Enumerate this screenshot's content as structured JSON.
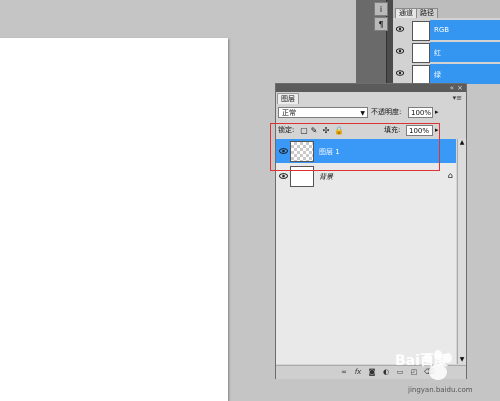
{
  "channels_panel": {
    "tabs": [
      {
        "label": "通道",
        "active": true
      },
      {
        "label": "路径",
        "active": false
      }
    ],
    "rows": [
      {
        "name": "RGB"
      },
      {
        "name": "红"
      },
      {
        "name": "绿"
      }
    ]
  },
  "layers_panel": {
    "tab_label": "图层",
    "menu_icon": "panel-menu-icon",
    "blend_mode": "正常",
    "opacity_label": "不透明度:",
    "opacity_value": "100%",
    "lock_label": "锁定:",
    "fill_label": "填充:",
    "fill_value": "100%",
    "layers": [
      {
        "name": "图层 1",
        "selected": true,
        "thumb": "transparent"
      },
      {
        "name": "背景",
        "selected": false,
        "thumb": "white",
        "locked": true
      }
    ]
  },
  "watermark": {
    "text": "Bai百度",
    "url": "jingyan.baidu.com"
  },
  "colors": {
    "selection": "#3a99f7",
    "canvas_bg": "#c5c5c5",
    "highlight_box": "#dd3333"
  }
}
